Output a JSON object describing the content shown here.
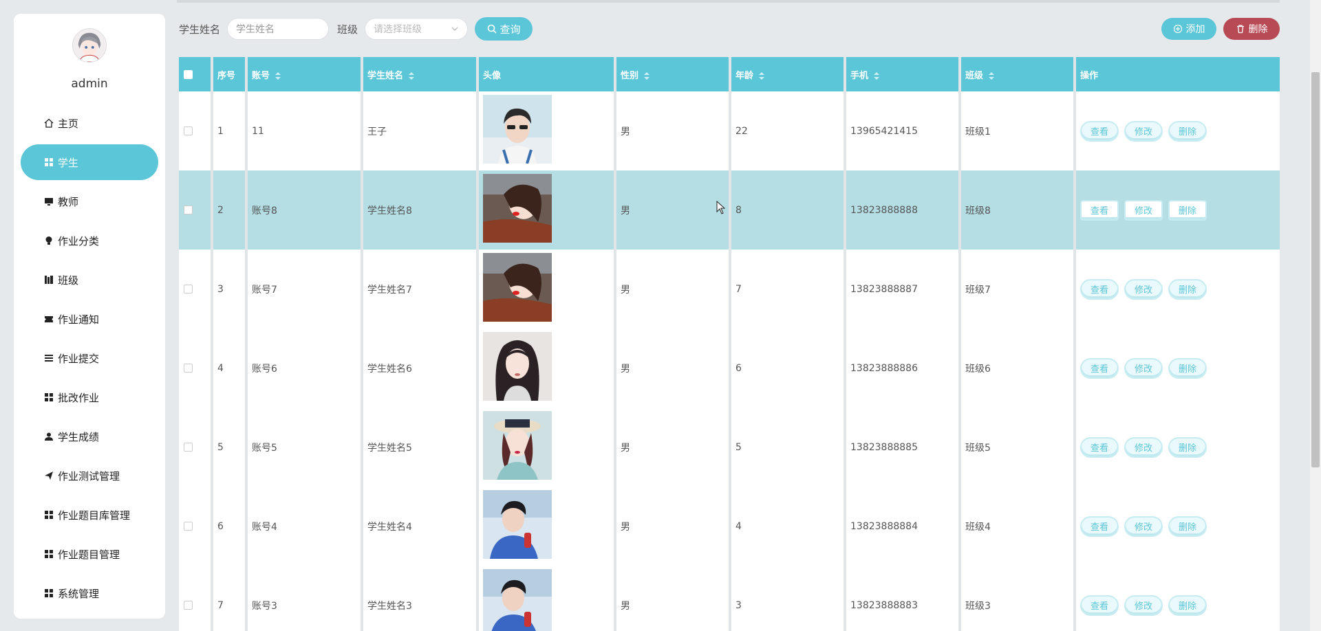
{
  "user": {
    "name": "admin"
  },
  "sidebar": {
    "items": [
      {
        "label": "主页",
        "icon": "home-icon"
      },
      {
        "label": "学生",
        "icon": "grid-icon",
        "active": true
      },
      {
        "label": "教师",
        "icon": "monitor-icon"
      },
      {
        "label": "作业分类",
        "icon": "bulb-icon"
      },
      {
        "label": "班级",
        "icon": "books-icon"
      },
      {
        "label": "作业通知",
        "icon": "ticket-icon"
      },
      {
        "label": "作业提交",
        "icon": "list-icon"
      },
      {
        "label": "批改作业",
        "icon": "grid-icon"
      },
      {
        "label": "学生成绩",
        "icon": "user-icon"
      },
      {
        "label": "作业测试管理",
        "icon": "paper-plane-icon"
      },
      {
        "label": "作业题目库管理",
        "icon": "grid-icon"
      },
      {
        "label": "作业题目管理",
        "icon": "grid-icon"
      },
      {
        "label": "系统管理",
        "icon": "grid-icon"
      }
    ]
  },
  "search": {
    "name_label": "学生姓名",
    "name_placeholder": "学生姓名",
    "class_label": "班级",
    "class_placeholder": "请选择班级",
    "query_label": "查询",
    "add_label": "添加",
    "delete_label": "删除"
  },
  "table": {
    "headers": [
      "序号",
      "账号",
      "学生姓名",
      "头像",
      "性别",
      "年龄",
      "手机",
      "班级",
      "操作"
    ],
    "actions": {
      "view": "查看",
      "edit": "修改",
      "delete": "删除"
    },
    "rows": [
      {
        "no": "1",
        "account": "11",
        "name": "王子",
        "gender": "男",
        "age": "22",
        "phone": "13965421415",
        "class": "班级1"
      },
      {
        "no": "2",
        "account": "账号8",
        "name": "学生姓名8",
        "gender": "男",
        "age": "8",
        "phone": "13823888888",
        "class": "班级8"
      },
      {
        "no": "3",
        "account": "账号7",
        "name": "学生姓名7",
        "gender": "男",
        "age": "7",
        "phone": "13823888887",
        "class": "班级7"
      },
      {
        "no": "4",
        "account": "账号6",
        "name": "学生姓名6",
        "gender": "男",
        "age": "6",
        "phone": "13823888886",
        "class": "班级6"
      },
      {
        "no": "5",
        "account": "账号5",
        "name": "学生姓名5",
        "gender": "男",
        "age": "5",
        "phone": "13823888885",
        "class": "班级5"
      },
      {
        "no": "6",
        "account": "账号4",
        "name": "学生姓名4",
        "gender": "男",
        "age": "4",
        "phone": "13823888884",
        "class": "班级4"
      },
      {
        "no": "7",
        "account": "账号3",
        "name": "学生姓名3",
        "gender": "男",
        "age": "3",
        "phone": "13823888883",
        "class": "班级3"
      }
    ]
  },
  "colors": {
    "accent": "#5bc6d8",
    "danger": "#b84a55",
    "highlight": "#b4dde4"
  }
}
